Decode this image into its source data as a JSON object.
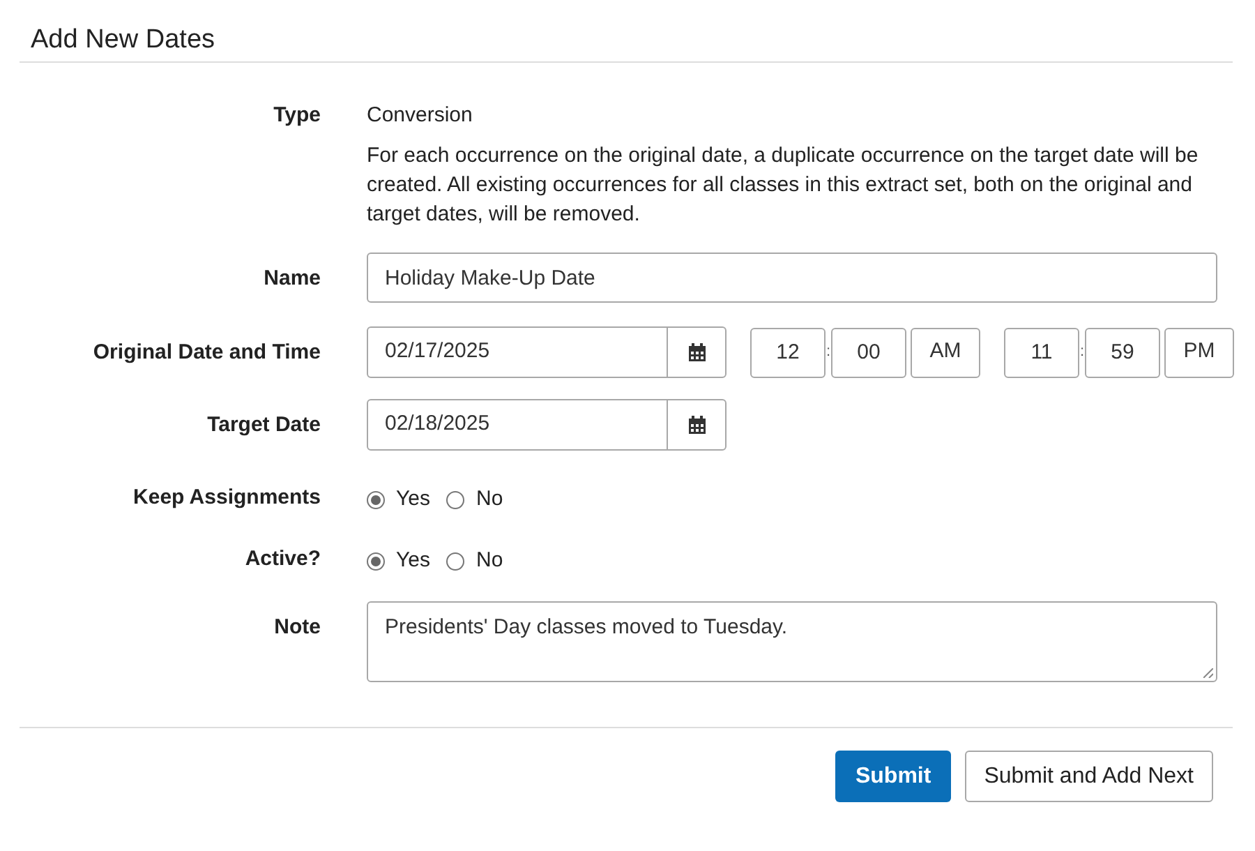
{
  "title": "Add New Dates",
  "fields": [
    {
      "kind": "text",
      "label": "Type",
      "value": "Conversion",
      "description": "For each occurrence on the original date, a duplicate occurrence on the target date will be created. All existing occurrences for all classes in this extract set, both on the original and target dates, will be removed."
    },
    {
      "kind": "input",
      "label": "Name",
      "value": "Holiday Make-Up Date"
    },
    {
      "kind": "datetime",
      "label": "Original Date and Time",
      "value": "02/17/2025",
      "start": {
        "hour": "12",
        "separator": ":",
        "minute": "00",
        "period": "AM"
      },
      "end": {
        "hour": "11",
        "separator": ":",
        "minute": "59",
        "period": "PM"
      }
    },
    {
      "kind": "date",
      "label": "Target Date",
      "value": "02/18/2025"
    },
    {
      "kind": "radio",
      "label": "Keep Assignments",
      "options": [
        {
          "label": "Yes",
          "selected": true
        },
        {
          "label": "No",
          "selected": false
        }
      ]
    },
    {
      "kind": "radio",
      "label": "Active?",
      "options": [
        {
          "label": "Yes",
          "selected": true
        },
        {
          "label": "No",
          "selected": false
        }
      ]
    },
    {
      "kind": "textarea",
      "label": "Note",
      "value": "Presidents' Day classes moved to Tuesday."
    }
  ],
  "buttons": [
    {
      "label": "Submit",
      "kind": "primary"
    },
    {
      "label": "Submit and Add Next",
      "kind": "secondary"
    }
  ]
}
